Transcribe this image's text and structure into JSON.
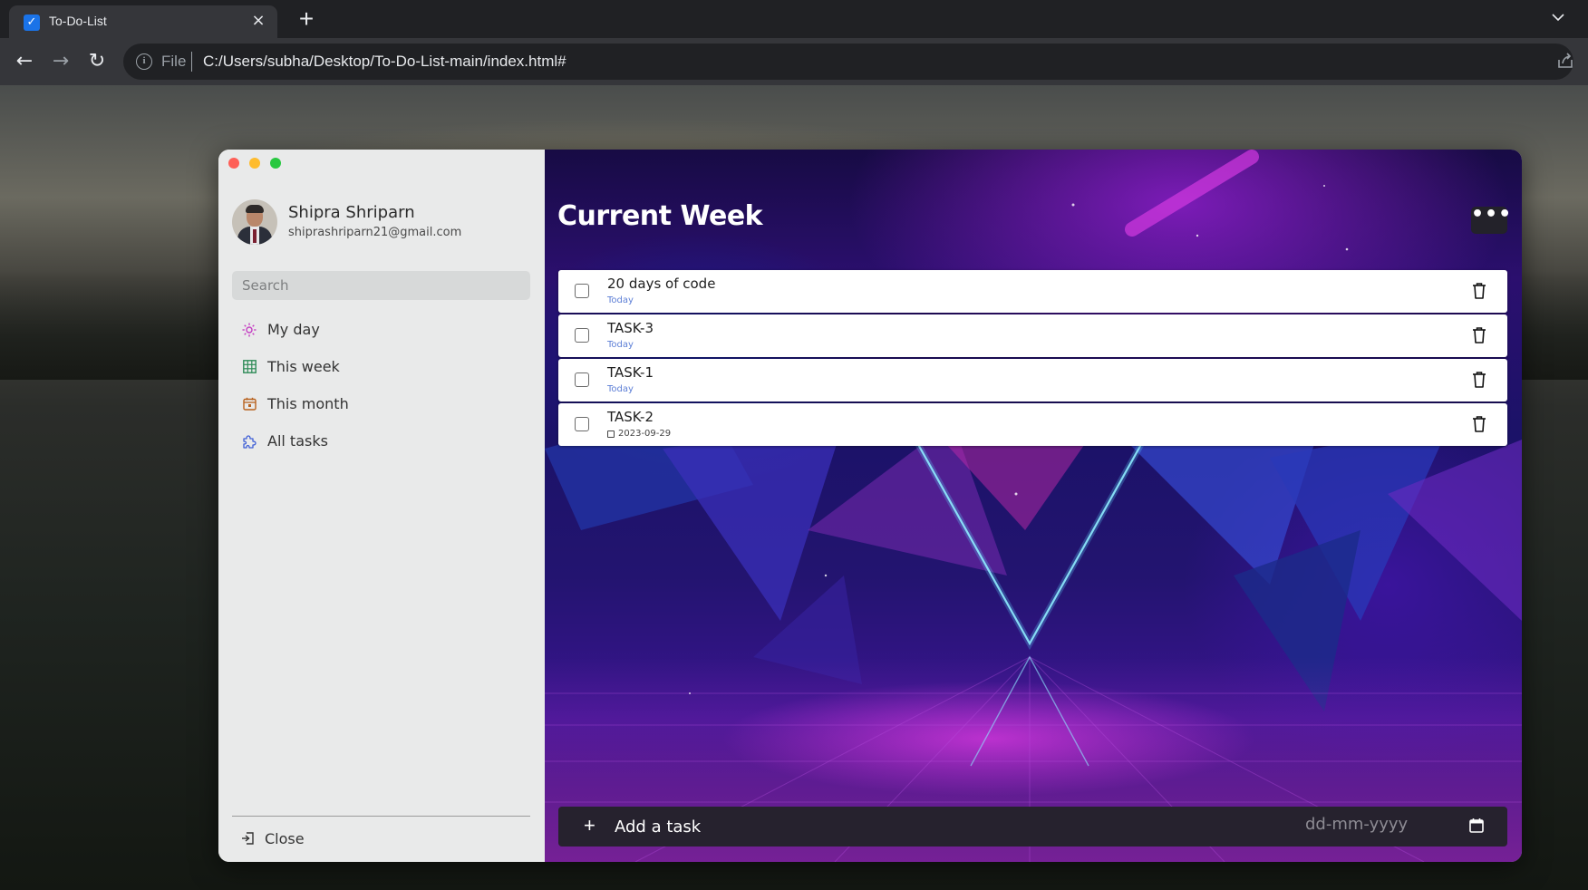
{
  "browser": {
    "tab_title": "To-Do-List",
    "new_tab_label": "+",
    "url_scheme": "File",
    "url": "C:/Users/subha/Desktop/To-Do-List-main/index.html#"
  },
  "sidebar": {
    "user": {
      "name": "Shipra Shriparn",
      "email": "shiprashriparn21@gmail.com"
    },
    "search_placeholder": "Search",
    "items": [
      {
        "label": "My day",
        "icon": "sun-icon",
        "color": "#c43dc1"
      },
      {
        "label": "This week",
        "icon": "grid-calendar-icon",
        "color": "#2e8b57"
      },
      {
        "label": "This month",
        "icon": "calendar-icon",
        "color": "#b8621e"
      },
      {
        "label": "All tasks",
        "icon": "puzzle-icon",
        "color": "#3f5fd6"
      }
    ],
    "close_label": "Close"
  },
  "main": {
    "title": "Current Week",
    "more_label": "•••",
    "tasks": [
      {
        "name": "20 days of code",
        "meta": "Today",
        "meta_type": "today"
      },
      {
        "name": "TASK-3",
        "meta": "Today",
        "meta_type": "today"
      },
      {
        "name": "TASK-1",
        "meta": "Today",
        "meta_type": "today"
      },
      {
        "name": "TASK-2",
        "meta": "2023-09-29",
        "meta_type": "date"
      }
    ],
    "add_task_placeholder": "Add a task",
    "add_task_plus": "+",
    "date_placeholder": "dd-mm-yyyy"
  },
  "colors": {
    "today_meta": "#5d7fd6",
    "sidebar_bg": "#e9eaea",
    "add_bar_bg": "#26222e"
  }
}
